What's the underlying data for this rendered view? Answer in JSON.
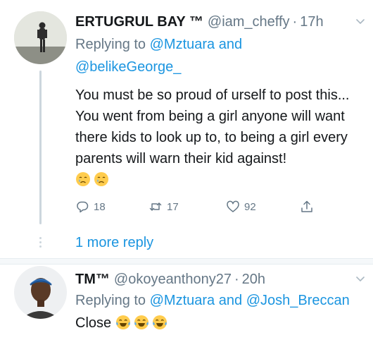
{
  "tweets": [
    {
      "name": "ERTUGRUL BAY ™",
      "handle": "@iam_cheffy",
      "separator": "·",
      "time": "17h",
      "replying_prefix": "Replying to",
      "mention_1": "@Mztuara",
      "replying_joiner": "and",
      "mention_2": "@belikeGeorge_",
      "body": "You must be so proud of urself to post this... You went from being a girl anyone will want there kids to look up to, to being a girl every parents will warn their kid against!",
      "emojis": [
        "crying-face",
        "crying-face"
      ],
      "actions": {
        "reply_count": "18",
        "retweet_count": "17",
        "like_count": "92"
      }
    },
    {
      "name": "TM™",
      "handle": "@okoyeanthony27",
      "separator": "·",
      "time": "20h",
      "replying_prefix": "Replying to",
      "mention_1": "@Mztuara",
      "replying_joiner": "and",
      "mention_2": "@Josh_Breccan",
      "body": "Close",
      "emojis": [
        "tears-of-joy",
        "tears-of-joy",
        "tears-of-joy"
      ]
    }
  ],
  "more_replies_label": "1 more reply",
  "colors": {
    "text": "#14171a",
    "muted": "#657786",
    "link": "#1b95e0",
    "thread_line": "#ccd6dd",
    "divider": "#e6ecf0"
  }
}
